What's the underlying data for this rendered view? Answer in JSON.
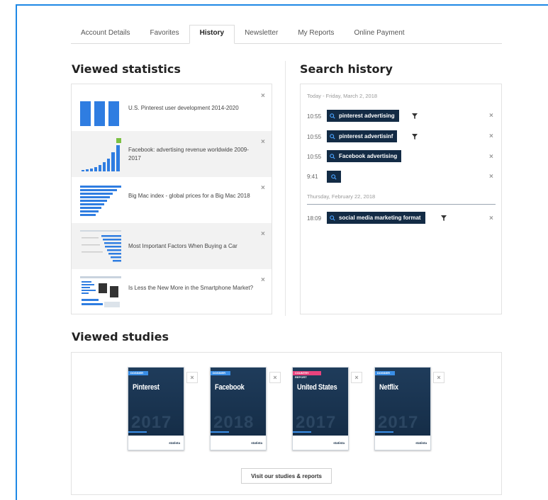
{
  "tabs": [
    {
      "label": "Account Details",
      "active": false
    },
    {
      "label": "Favorites",
      "active": false
    },
    {
      "label": "History",
      "active": true
    },
    {
      "label": "Newsletter",
      "active": false
    },
    {
      "label": "My Reports",
      "active": false
    },
    {
      "label": "Online Payment",
      "active": false
    }
  ],
  "viewed_statistics": {
    "heading": "Viewed statistics",
    "items": [
      {
        "title": "U.S. Pinterest user development 2014-2020",
        "thumb": "bar-chart-icon"
      },
      {
        "title": "Facebook: advertising revenue worldwide 2009-2017",
        "thumb": "growth-bar-chart-icon"
      },
      {
        "title": "Big Mac index - global prices for a Big Mac 2018",
        "thumb": "horizontal-bar-chart-icon"
      },
      {
        "title": "Most Important Factors When Buying a Car",
        "thumb": "horizontal-bar-chart-icon"
      },
      {
        "title": "Is Less the New More in the Smartphone Market?",
        "thumb": "infographic-icon"
      }
    ]
  },
  "search_history": {
    "heading": "Search history",
    "groups": [
      {
        "date": "Today - Friday, March 2, 2018",
        "entries": [
          {
            "time": "10:55",
            "query": "pinterest advertising",
            "filter": true
          },
          {
            "time": "10:55",
            "query": "pinterest advertisinf",
            "filter": true
          },
          {
            "time": "10:55",
            "query": "Facebook advertising",
            "filter": false
          },
          {
            "time": "9:41",
            "query": "",
            "filter": false
          }
        ]
      },
      {
        "date": "Thursday, February 22, 2018",
        "entries": [
          {
            "time": "18:09",
            "query": "social media marketing format",
            "filter": true
          }
        ]
      }
    ]
  },
  "viewed_studies": {
    "heading": "Viewed studies",
    "items": [
      {
        "badge": "DOSSIER",
        "badge_color": "#3a8ee6",
        "title": "Pinterest",
        "year": "2017",
        "brand": "statista"
      },
      {
        "badge": "DOSSIER",
        "badge_color": "#3a8ee6",
        "title": "Facebook",
        "year": "2018",
        "brand": "statista"
      },
      {
        "badge": "COUNTRY REPORT",
        "badge_color": "#e8437d",
        "title": "United States",
        "year": "2017",
        "brand": "statista"
      },
      {
        "badge": "DOSSIER",
        "badge_color": "#3a8ee6",
        "title": "Netflix",
        "year": "2017",
        "brand": "statista"
      }
    ],
    "button_label": "Visit our studies & reports"
  },
  "close_glyph": "×",
  "colors": {
    "accent": "#1e88e5",
    "chip": "#132b45",
    "bar_blue": "#2f7de1"
  }
}
